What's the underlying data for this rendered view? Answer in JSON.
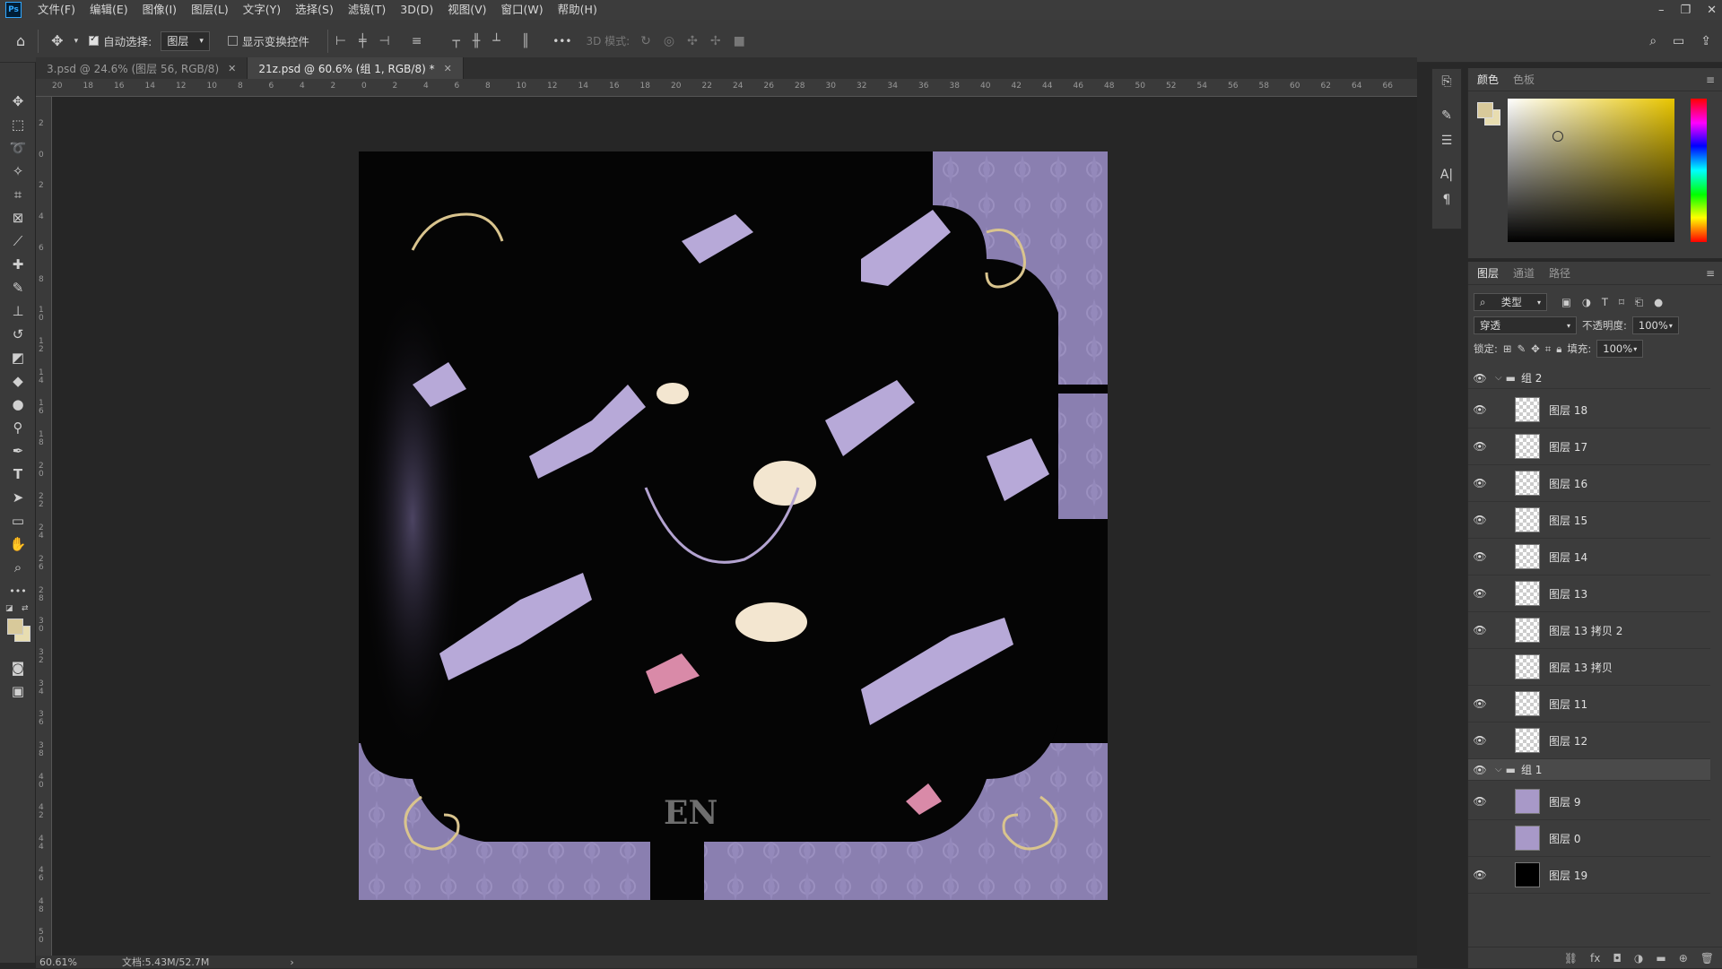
{
  "app": {
    "logo": "Ps"
  },
  "menu": [
    "文件(F)",
    "编辑(E)",
    "图像(I)",
    "图层(L)",
    "文字(Y)",
    "选择(S)",
    "滤镜(T)",
    "3D(D)",
    "视图(V)",
    "窗口(W)",
    "帮助(H)"
  ],
  "window_controls": {
    "minimize": "–",
    "restore": "❐",
    "close": "✕"
  },
  "options": {
    "auto_select_label": "自动选择:",
    "auto_select_checked": true,
    "target_value": "图层",
    "show_transform_label": "显示变换控件",
    "show_transform_checked": false,
    "more": "•••",
    "mode_3d_label": "3D 模式:"
  },
  "tabs": [
    {
      "label": "3.psd @ 24.6% (图层 56, RGB/8)",
      "active": false
    },
    {
      "label": "21z.psd @ 60.6% (组 1, RGB/8) *",
      "active": true
    }
  ],
  "ruler_h": [
    "20",
    "18",
    "16",
    "14",
    "12",
    "10",
    "8",
    "6",
    "4",
    "2",
    "0",
    "2",
    "4",
    "6",
    "8",
    "10",
    "12",
    "14",
    "16",
    "18",
    "20",
    "22",
    "24",
    "26",
    "28",
    "30",
    "32",
    "34",
    "36",
    "38",
    "40",
    "42",
    "44",
    "46",
    "48",
    "50",
    "52",
    "54",
    "56",
    "58",
    "60",
    "62",
    "64",
    "66"
  ],
  "ruler_v": [
    "2",
    "0",
    "2",
    "4",
    "6",
    "8",
    "1 0",
    "1 2",
    "1 4",
    "1 6",
    "1 8",
    "2 0",
    "2 2",
    "2 4",
    "2 6",
    "2 8",
    "3 0",
    "3 2",
    "3 4",
    "3 6",
    "3 8",
    "4 0",
    "4 2",
    "4 4",
    "4 6",
    "4 8",
    "5 0"
  ],
  "status": {
    "zoom": "60.61%",
    "doc": "文档:5.43M/52.7M",
    "arrow": "›"
  },
  "color_panel": {
    "tabs": [
      "颜色",
      "色板"
    ],
    "menu": "≡",
    "fg": "#d8c99a",
    "bg": "#e8ddb0"
  },
  "layers_panel": {
    "tabs": [
      "图层",
      "通道",
      "路径"
    ],
    "filter_label": "类型",
    "blend_mode": "穿透",
    "opacity_label": "不透明度:",
    "opacity_value": "100%",
    "lock_label": "锁定:",
    "fill_label": "填充:",
    "fill_value": "100%",
    "layers": [
      {
        "name": "组 2",
        "type": "group",
        "visible": true
      },
      {
        "name": "图层 18",
        "type": "layer",
        "visible": true
      },
      {
        "name": "图层 17",
        "type": "layer",
        "visible": true
      },
      {
        "name": "图层 16",
        "type": "layer",
        "visible": true
      },
      {
        "name": "图层 15",
        "type": "layer",
        "visible": true
      },
      {
        "name": "图层 14",
        "type": "layer",
        "visible": true
      },
      {
        "name": "图层 13",
        "type": "layer",
        "visible": true
      },
      {
        "name": "图层 13 拷贝 2",
        "type": "layer",
        "visible": true
      },
      {
        "name": "图层 13 拷贝",
        "type": "layer",
        "visible": false
      },
      {
        "name": "图层 11",
        "type": "layer",
        "visible": true
      },
      {
        "name": "图层 12",
        "type": "layer",
        "visible": true
      },
      {
        "name": "组 1",
        "type": "group",
        "visible": true,
        "selected": true
      },
      {
        "name": "图层 9",
        "type": "layer",
        "visible": true
      },
      {
        "name": "图层 0",
        "type": "layer",
        "visible": false
      },
      {
        "name": "图层 19",
        "type": "layer",
        "visible": true
      }
    ]
  },
  "canvas_text": "EN"
}
